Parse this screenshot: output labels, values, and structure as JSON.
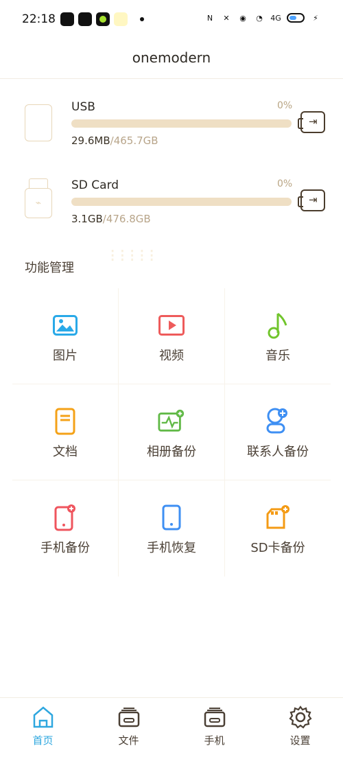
{
  "status": {
    "time": "22:18"
  },
  "header": {
    "title": "onemodern"
  },
  "storage": [
    {
      "name": "USB",
      "percent": "0%",
      "used": "29.6MB",
      "total": "/465.7GB",
      "fill": 0
    },
    {
      "name": "SD Card",
      "percent": "0%",
      "used": "3.1GB",
      "total": "/476.8GB",
      "fill": 0
    }
  ],
  "section": {
    "title": "功能管理"
  },
  "features": [
    {
      "label": "图片",
      "icon": "image-icon"
    },
    {
      "label": "视频",
      "icon": "video-icon"
    },
    {
      "label": "音乐",
      "icon": "music-icon"
    },
    {
      "label": "文档",
      "icon": "document-icon"
    },
    {
      "label": "相册备份",
      "icon": "album-backup-icon"
    },
    {
      "label": "联系人备份",
      "icon": "contact-backup-icon"
    },
    {
      "label": "手机备份",
      "icon": "phone-backup-icon"
    },
    {
      "label": "手机恢复",
      "icon": "phone-restore-icon"
    },
    {
      "label": "SD卡备份",
      "icon": "sd-backup-icon"
    }
  ],
  "nav": [
    {
      "label": "首页",
      "icon": "home-icon",
      "active": true
    },
    {
      "label": "文件",
      "icon": "files-icon",
      "active": false
    },
    {
      "label": "手机",
      "icon": "phone-icon",
      "active": false
    },
    {
      "label": "设置",
      "icon": "settings-icon",
      "active": false
    }
  ],
  "colors": {
    "accent": "#2ea7df",
    "progress": "#efdfc4",
    "muted": "#b8a58a"
  }
}
